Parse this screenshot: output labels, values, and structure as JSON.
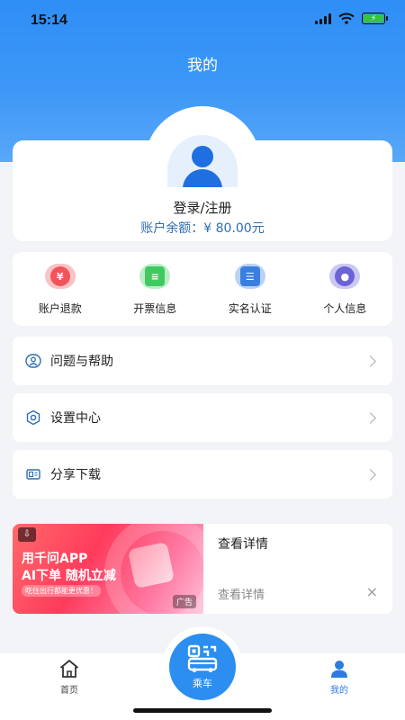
{
  "status_bar": {
    "time": "15:14"
  },
  "header": {
    "title": "我的"
  },
  "profile": {
    "login_label": "登录/注册",
    "balance_label": "账户余额：",
    "balance_value": "¥ 80.00元"
  },
  "quick_actions": [
    {
      "label": "账户退款",
      "icon": "refund-icon",
      "color": "#f2545b"
    },
    {
      "label": "开票信息",
      "icon": "invoice-icon",
      "color": "#3fca5f"
    },
    {
      "label": "实名认证",
      "icon": "id-card-icon",
      "color": "#3a7fe0"
    },
    {
      "label": "个人信息",
      "icon": "location-user-icon",
      "color": "#6b63d6"
    }
  ],
  "menu": [
    {
      "label": "问题与帮助",
      "icon": "help-icon"
    },
    {
      "label": "设置中心",
      "icon": "gear-icon"
    },
    {
      "label": "分享下载",
      "icon": "share-icon"
    }
  ],
  "ad": {
    "image_line1": "用千问APP",
    "image_line2": "AI下单 随机立减",
    "image_line3": "吃住出行都能更优惠！",
    "image_tag": "广告",
    "title": "查看详情",
    "subtitle": "查看详情",
    "close": "×"
  },
  "tab_bar": {
    "home": "首页",
    "ride": "乘车",
    "mine": "我的",
    "active_color": "#2c7be5",
    "inactive_color": "#444444"
  }
}
